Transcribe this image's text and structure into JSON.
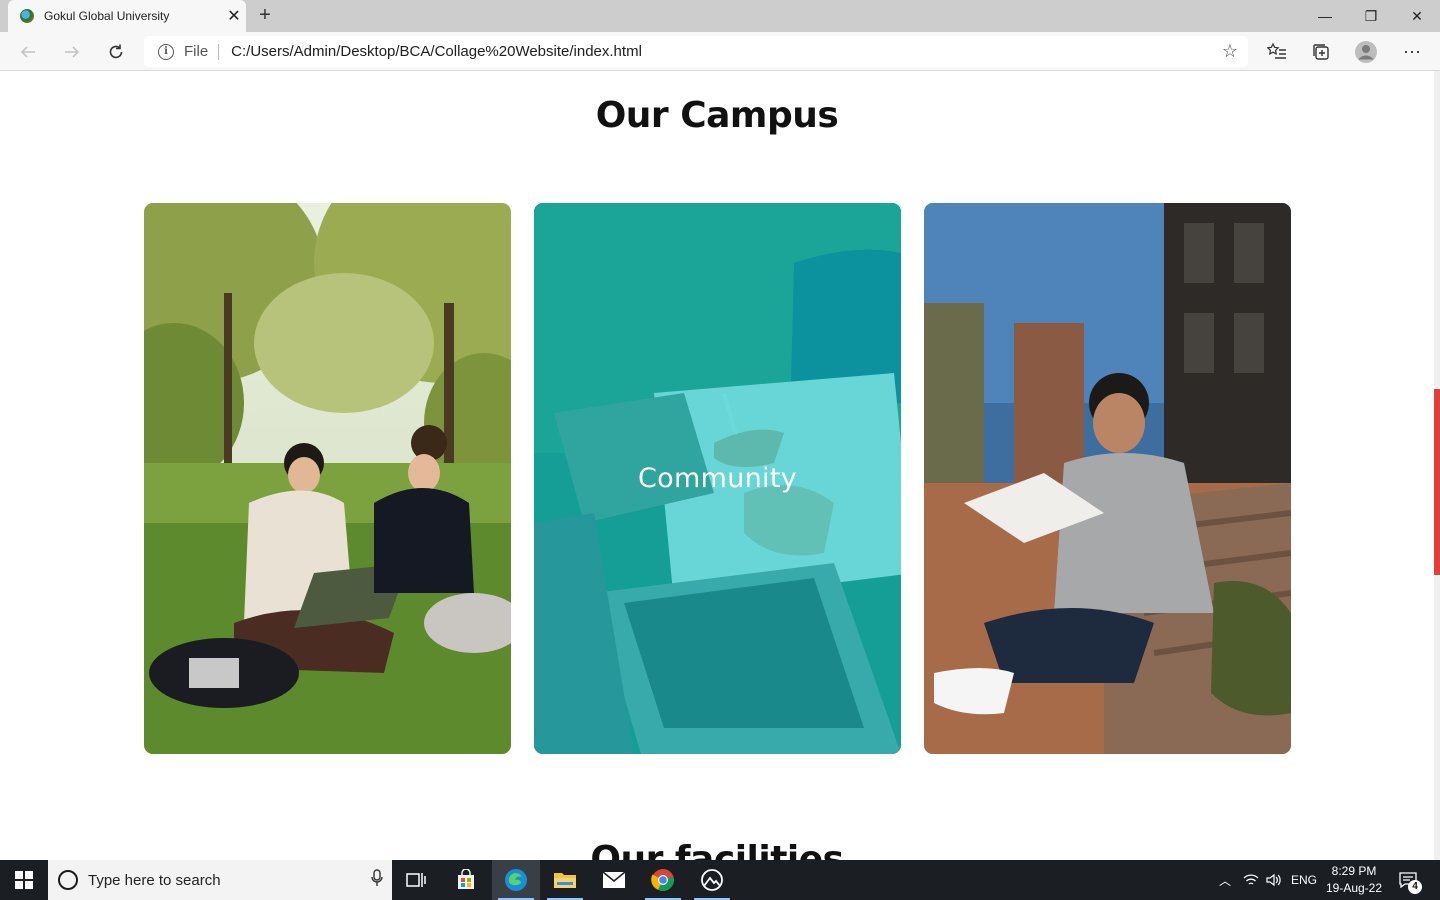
{
  "browser": {
    "tab_title": "Gokul Global University",
    "tab_close": "✕",
    "new_tab": "+",
    "window_controls": {
      "minimize": "—",
      "maximize": "❐",
      "close": "✕"
    },
    "omnibox": {
      "scheme_label": "File",
      "url": "C:/Users/Admin/Desktop/BCA/Collage%20Website/index.html"
    }
  },
  "page": {
    "campus_title": "Our Campus",
    "cards": [
      {
        "image": "students-on-grass-with-laptop"
      },
      {
        "image": "hands-writing-with-laptop",
        "overlay_label": "Community",
        "overlay_color": "#00c8c8"
      },
      {
        "image": "student-sitting-on-steps-with-papers"
      }
    ],
    "facilities_title": "Our facilities",
    "scroll_thumb_color": "#e0403c"
  },
  "taskbar": {
    "search_placeholder": "Type here to search",
    "tray_lang": "ENG",
    "time": "8:29 PM",
    "date": "19-Aug-22",
    "notification_count": "4"
  }
}
